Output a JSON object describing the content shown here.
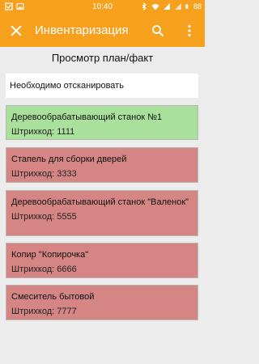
{
  "status_bar": {
    "time": "10:40",
    "battery": "88",
    "icons": [
      "checkbox-icon",
      "image-icon",
      "bluetooth-icon",
      "wifi-icon",
      "signal-icon",
      "signal-icon"
    ]
  },
  "app_bar": {
    "title": "Инвентаризация",
    "color": "#f7a01e",
    "close_icon": "close-icon",
    "search_icon": "search-icon",
    "menu_icon": "more-vert-icon"
  },
  "page": {
    "title": "Просмотр план/факт",
    "notice": "Необходимо отсканировать"
  },
  "items": [
    {
      "name": "Деревообрабатывающий станок №1",
      "code": "Штрихкод: 1111",
      "status": "scanned",
      "color": "#a9e09b"
    },
    {
      "name": "Стапель для сборки дверей",
      "code": "Штрихкод: 3333",
      "status": "not_scanned",
      "color": "#d68585"
    },
    {
      "name": "Деревообрабатывающий станок \"Валенок\"",
      "code": "Штрихкод: 5555",
      "status": "not_scanned",
      "color": "#d68585"
    },
    {
      "name": "Копир \"Копирочка\"",
      "code": "Штрихкод: 6666",
      "status": "not_scanned",
      "color": "#d68585"
    },
    {
      "name": "Смеситель бытовой",
      "code": "Штрихкод: 7777",
      "status": "not_scanned",
      "color": "#d68585"
    }
  ]
}
